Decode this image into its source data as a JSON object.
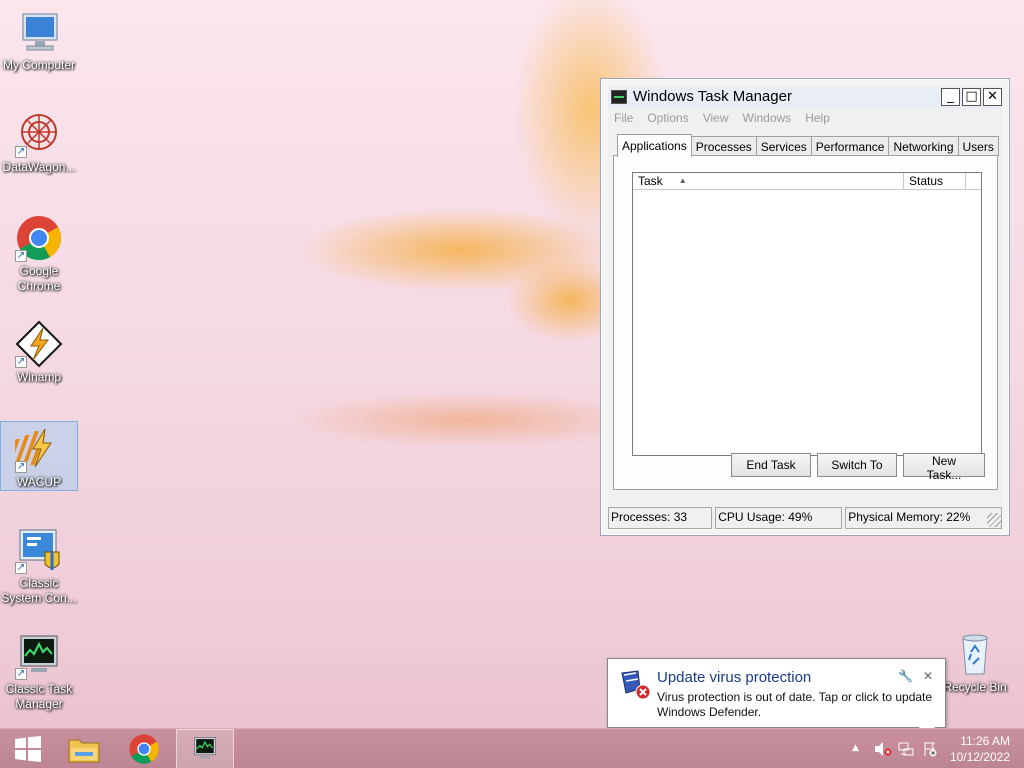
{
  "desktop": {
    "icons": [
      {
        "label": "My Computer"
      },
      {
        "label": "DataWagon..."
      },
      {
        "label": "Google Chrome"
      },
      {
        "label": "Winamp"
      },
      {
        "label": "WACUP"
      },
      {
        "label": "Classic System Con..."
      },
      {
        "label": "Classic Task Manager"
      },
      {
        "label": "Recycle Bin"
      }
    ]
  },
  "task_manager": {
    "title": "Windows Task Manager",
    "window_buttons": {
      "minimize": "_",
      "maximize": "□",
      "close": "✕"
    },
    "menu": [
      "File",
      "Options",
      "View",
      "Windows",
      "Help"
    ],
    "tabs": [
      "Applications",
      "Processes",
      "Services",
      "Performance",
      "Networking",
      "Users"
    ],
    "active_tab": "Applications",
    "columns": {
      "task": "Task",
      "status": "Status"
    },
    "buttons": {
      "end_task": "End Task",
      "switch_to": "Switch To",
      "new_task": "New Task..."
    },
    "status_bar": {
      "processes": "Processes: 33",
      "cpu": "CPU Usage: 49%",
      "memory": "Physical Memory: 22%"
    }
  },
  "notification": {
    "title": "Update virus protection",
    "text": "Virus protection is out of date. Tap or click to update Windows Defender."
  },
  "taskbar": {
    "clock_time": "11:26 AM",
    "clock_date": "10/12/2022",
    "tray_overflow": "▲"
  },
  "colors": {
    "accent_title": "#1a3b8a",
    "taskbar": "#c08896"
  }
}
